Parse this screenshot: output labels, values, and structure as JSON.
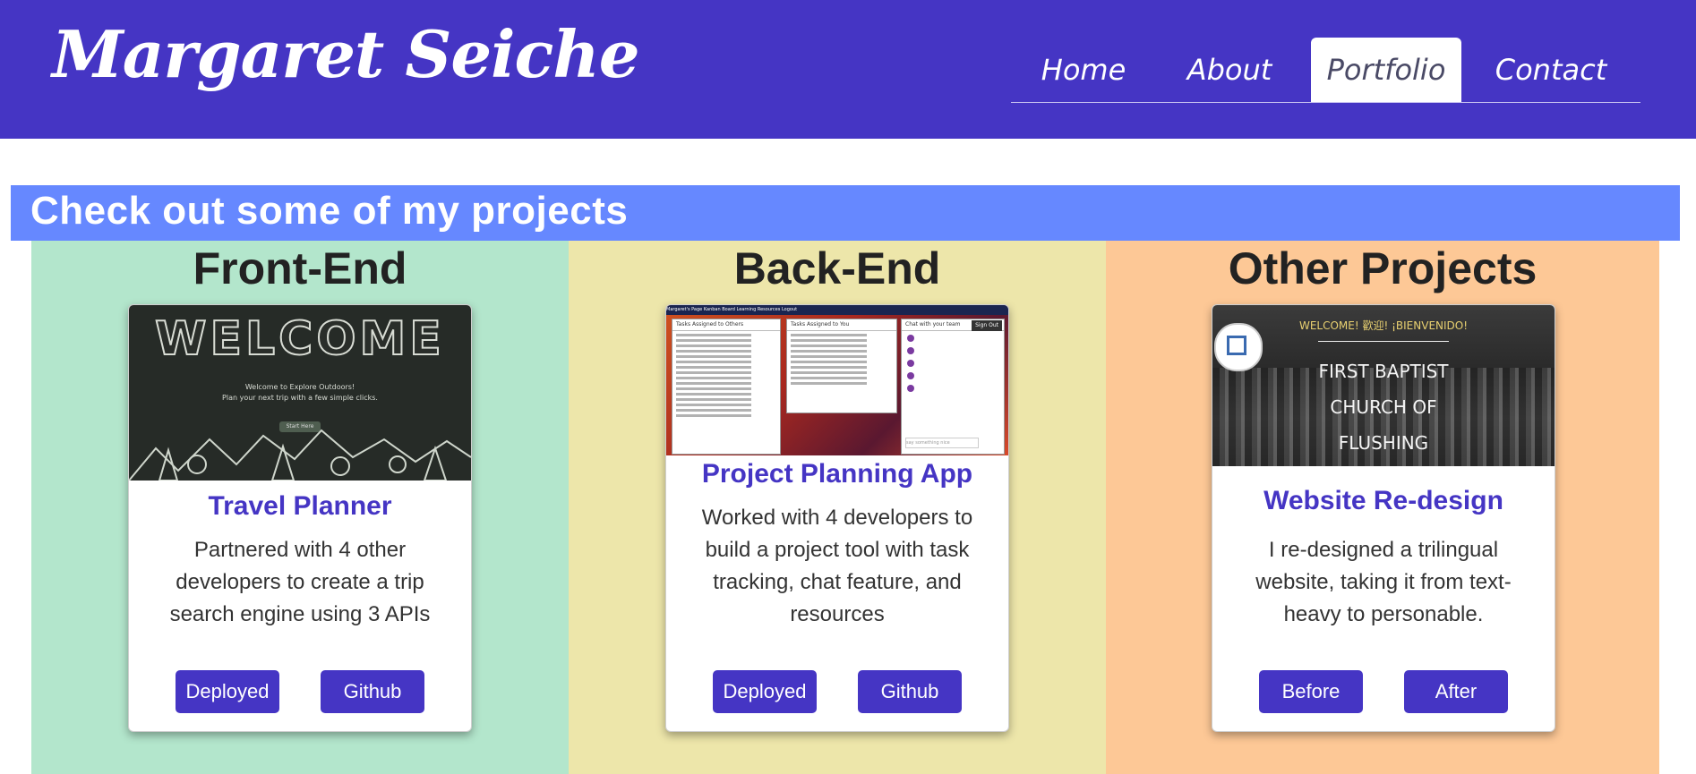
{
  "header": {
    "brand": "Margaret Seiche",
    "nav": [
      {
        "label": "Home"
      },
      {
        "label": "About"
      },
      {
        "label": "Portfolio"
      },
      {
        "label": "Contact"
      }
    ]
  },
  "banner": {
    "title": "Check out some of my projects"
  },
  "columns": [
    {
      "heading": "Front-End",
      "card": {
        "title": "Travel Planner",
        "desc": "Partnered with 4 other developers to create a trip search engine using 3 APIs",
        "buttons": [
          "Deployed",
          "Github"
        ],
        "thumb": {
          "welcome": "WELCOME",
          "line1": "Welcome to Explore Outdoors!",
          "line2": "Plan your next trip with a few simple clicks.",
          "button": "Start Here"
        }
      }
    },
    {
      "heading": "Back-End",
      "card": {
        "title": "Project Planning App",
        "desc": "Worked with 4 developers to build a project tool with task tracking, chat feature, and resources",
        "buttons": [
          "Deployed",
          "Github"
        ],
        "thumb": {
          "topbar": "Margaret's Page   Kanban Board   Learning Resources   Logout",
          "panel1": "Tasks Assigned to Others",
          "panel2": "Tasks Assigned to You",
          "panel3": "Chat with your team",
          "signout": "Sign Out",
          "chat_placeholder": "say something nice"
        }
      }
    },
    {
      "heading": "Other Projects",
      "card": {
        "title": "Website Re-design",
        "desc": "I re-designed a trilingual website, taking it from text-heavy to personable.",
        "buttons": [
          "Before",
          "After"
        ],
        "thumb": {
          "welcome": "WELCOME! 歡迎! ¡BIENVENIDO!",
          "line1": "FIRST BAPTIST",
          "line2": "CHURCH OF",
          "line3": "FLUSHING"
        }
      }
    }
  ],
  "colors": {
    "header": "#4535c4",
    "banner": "#6688ff",
    "frontend_bg": "#b3e6cc",
    "backend_bg": "#ede6aa",
    "other_bg": "#fdc896",
    "accent": "#4535c4"
  }
}
